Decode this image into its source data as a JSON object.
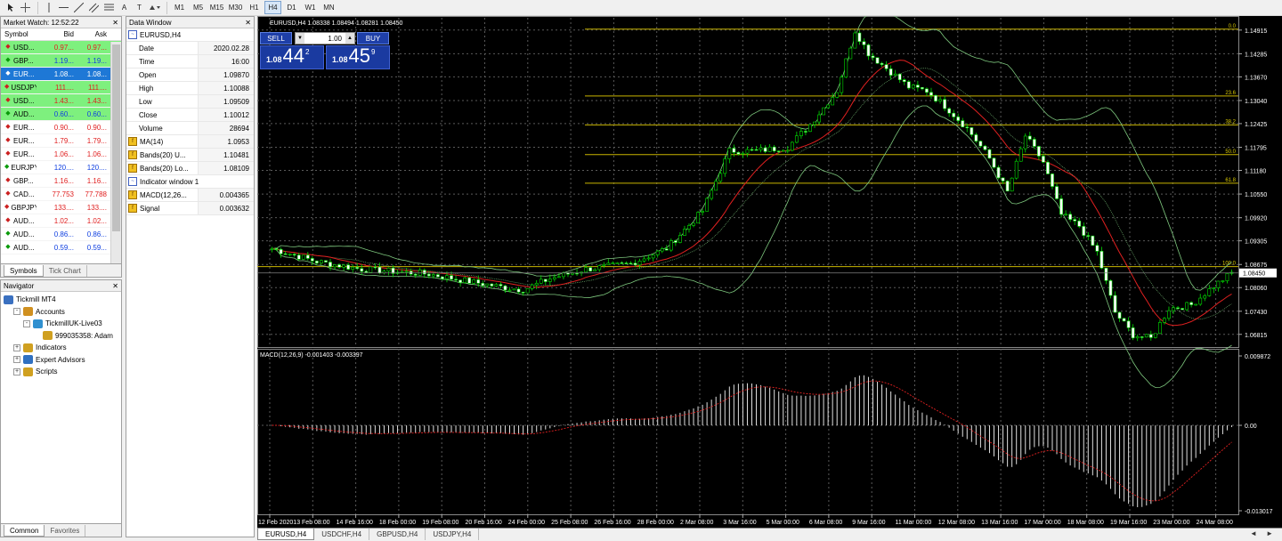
{
  "toolbar": {
    "timeframes": [
      "M1",
      "M5",
      "M15",
      "M30",
      "H1",
      "H4",
      "D1",
      "W1",
      "MN"
    ],
    "active_timeframe": "H4",
    "text_tool": "A",
    "tool_labels": [
      "T"
    ]
  },
  "market_watch": {
    "title": "Market Watch: 12:52:22",
    "columns": {
      "symbol": "Symbol",
      "bid": "Bid",
      "ask": "Ask"
    },
    "rows": [
      {
        "symbol": "USD...",
        "bid": "0.97...",
        "ask": "0.97...",
        "dir": "down",
        "bg": "#7ef07e"
      },
      {
        "symbol": "GBP...",
        "bid": "1.19...",
        "ask": "1.19...",
        "dir": "up",
        "bg": "#7ef07e"
      },
      {
        "symbol": "EUR...",
        "bid": "1.08...",
        "ask": "1.08...",
        "dir": "up",
        "bg": "#1e78d6",
        "selected": true
      },
      {
        "symbol": "USDJPY",
        "bid": "111....",
        "ask": "111....",
        "dir": "down",
        "bg": "#7ef07e"
      },
      {
        "symbol": "USD...",
        "bid": "1.43...",
        "ask": "1.43...",
        "dir": "down",
        "bg": "#7ef07e"
      },
      {
        "symbol": "AUD...",
        "bid": "0.60...",
        "ask": "0.60...",
        "dir": "up",
        "bg": "#7ef07e"
      },
      {
        "symbol": "EUR...",
        "bid": "0.90...",
        "ask": "0.90...",
        "dir": "down",
        "bg": "#ffffff"
      },
      {
        "symbol": "EUR...",
        "bid": "1.79...",
        "ask": "1.79...",
        "dir": "down",
        "bg": "#ffffff"
      },
      {
        "symbol": "EUR...",
        "bid": "1.06...",
        "ask": "1.06...",
        "dir": "down",
        "bg": "#ffffff"
      },
      {
        "symbol": "EURJPY",
        "bid": "120....",
        "ask": "120....",
        "dir": "up",
        "bg": "#ffffff"
      },
      {
        "symbol": "GBP...",
        "bid": "1.16...",
        "ask": "1.16...",
        "dir": "down",
        "bg": "#ffffff"
      },
      {
        "symbol": "CAD...",
        "bid": "77.753",
        "ask": "77.788",
        "dir": "down",
        "bg": "#ffffff"
      },
      {
        "symbol": "GBPJPY",
        "bid": "133....",
        "ask": "133....",
        "dir": "down",
        "bg": "#ffffff"
      },
      {
        "symbol": "AUD...",
        "bid": "1.02...",
        "ask": "1.02...",
        "dir": "down",
        "bg": "#ffffff"
      },
      {
        "symbol": "AUD...",
        "bid": "0.86...",
        "ask": "0.86...",
        "dir": "up",
        "bg": "#ffffff"
      },
      {
        "symbol": "AUD...",
        "bid": "0.59...",
        "ask": "0.59...",
        "dir": "up",
        "bg": "#ffffff"
      }
    ],
    "tabs": [
      "Symbols",
      "Tick Chart"
    ]
  },
  "navigator": {
    "title": "Navigator",
    "items": [
      {
        "label": "Tickmill MT4",
        "level": 0,
        "exp": ""
      },
      {
        "label": "Accounts",
        "level": 1,
        "exp": "-"
      },
      {
        "label": "TickmillUK-Live03",
        "level": 2,
        "exp": "-"
      },
      {
        "label": "999035358: Adam",
        "level": 3,
        "exp": ""
      },
      {
        "label": "Indicators",
        "level": 1,
        "exp": "+"
      },
      {
        "label": "Expert Advisors",
        "level": 1,
        "exp": "+"
      },
      {
        "label": "Scripts",
        "level": 1,
        "exp": "+"
      }
    ],
    "tabs": [
      "Common",
      "Favorites"
    ]
  },
  "data_window": {
    "title": "Data Window",
    "symbol": "EURUSD,H4",
    "rows": [
      {
        "k": "Date",
        "v": "2020.02.28"
      },
      {
        "k": "Time",
        "v": "16:00"
      },
      {
        "k": "Open",
        "v": "1.09870"
      },
      {
        "k": "High",
        "v": "1.10088"
      },
      {
        "k": "Low",
        "v": "1.09509"
      },
      {
        "k": "Close",
        "v": "1.10012"
      },
      {
        "k": "Volume",
        "v": "28694"
      },
      {
        "k": "MA(14)",
        "v": "1.0953",
        "icon": "f"
      },
      {
        "k": "Bands(20) U...",
        "v": "1.10481",
        "icon": "f"
      },
      {
        "k": "Bands(20) Lo...",
        "v": "1.08109",
        "icon": "f"
      },
      {
        "k": "Indicator window 1",
        "v": "",
        "icon": "w"
      },
      {
        "k": "MACD(12,26...",
        "v": "0.004365",
        "icon": "f"
      },
      {
        "k": "Signal",
        "v": "0.003632",
        "icon": "f"
      }
    ]
  },
  "chart": {
    "title": "EURUSD,H4  1.08338 1.08494 1.08281 1.08450",
    "sell_label": "SELL",
    "buy_label": "BUY",
    "lot": "1.00",
    "sell_price": {
      "prefix": "1.08",
      "big": "44",
      "sup": "2"
    },
    "buy_price": {
      "prefix": "1.08",
      "big": "45",
      "sup": "9"
    },
    "macd_label": "MACD(12,26,9) -0.001403 -0.003397",
    "price_ticks": [
      "1.14915",
      "1.14285",
      "1.13670",
      "1.13040",
      "1.12425",
      "1.11795",
      "1.11180",
      "1.10550",
      "1.09920",
      "1.09305",
      "1.08675",
      "1.08060",
      "1.07430",
      "1.06815"
    ],
    "current_price": "1.08450",
    "macd_ticks": [
      "0.009872",
      "0.00",
      "-0.013017"
    ],
    "fib_labels": [
      "0.0",
      "23.6",
      "38.2",
      "50.0",
      "61.8",
      "100.0"
    ],
    "time_labels": [
      "12 Feb 2020",
      "13 Feb 08:00",
      "14 Feb 16:00",
      "18 Feb 00:00",
      "19 Feb 08:00",
      "20 Feb 16:00",
      "24 Feb 00:00",
      "25 Feb 08:00",
      "26 Feb 16:00",
      "28 Feb 00:00",
      "2 Mar 08:00",
      "3 Mar 16:00",
      "5 Mar 00:00",
      "6 Mar 08:00",
      "9 Mar 16:00",
      "11 Mar 00:00",
      "12 Mar 08:00",
      "13 Mar 16:00",
      "17 Mar 00:00",
      "18 Mar 08:00",
      "19 Mar 16:00",
      "23 Mar 00:00",
      "24 Mar 08:00"
    ]
  },
  "chart_tabs": [
    "EURUSD,H4",
    "USDCHF,H4",
    "GBPUSD,H4",
    "USDJPY,H4"
  ],
  "chart_tabs_nav": "◄ ►"
}
